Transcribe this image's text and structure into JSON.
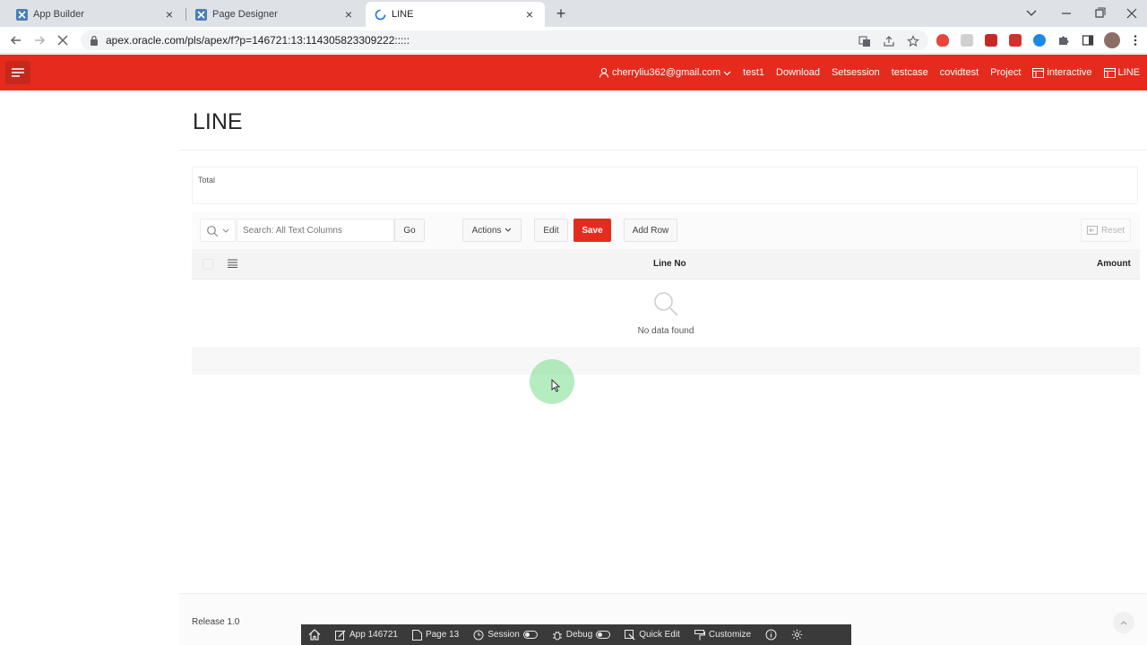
{
  "browser": {
    "tabs": [
      {
        "title": "App Builder",
        "active": false
      },
      {
        "title": "Page Designer",
        "active": false
      },
      {
        "title": "LINE",
        "active": true
      }
    ],
    "new_tab_label": "+",
    "close_glyph": "×",
    "url": "apex.oracle.com/pls/apex/f?p=146721:13:114305823309222:::::",
    "icons": {
      "back": "back-arrow-icon",
      "forward": "forward-arrow-icon",
      "reload": "stop-loading-icon",
      "lock": "lock-icon",
      "translate": "translate-icon",
      "share": "share-icon",
      "bookmark": "star-icon"
    }
  },
  "apex": {
    "brand_color": "#e52b1d",
    "nav": {
      "user": "cherryliu362@gmail.com",
      "links": [
        "test1",
        "Download",
        "Setsession",
        "testcase",
        "covidtest",
        "Project"
      ],
      "icon_links": [
        "interactive",
        "LINE"
      ]
    },
    "page_title": "LINE",
    "total_label": "Total",
    "grid": {
      "search_placeholder": "Search: All Text Columns",
      "go_label": "Go",
      "actions_label": "Actions",
      "edit_label": "Edit",
      "save_label": "Save",
      "add_row_label": "Add Row",
      "reset_label": "Reset",
      "columns": [
        "Line No",
        "Amount"
      ],
      "empty_message": "No data found"
    },
    "footer": {
      "release": "Release 1.0"
    },
    "devbar": {
      "app": "App 146721",
      "page": "Page 13",
      "session": "Session",
      "debug": "Debug",
      "quick_edit": "Quick Edit",
      "customize": "Customize"
    }
  }
}
